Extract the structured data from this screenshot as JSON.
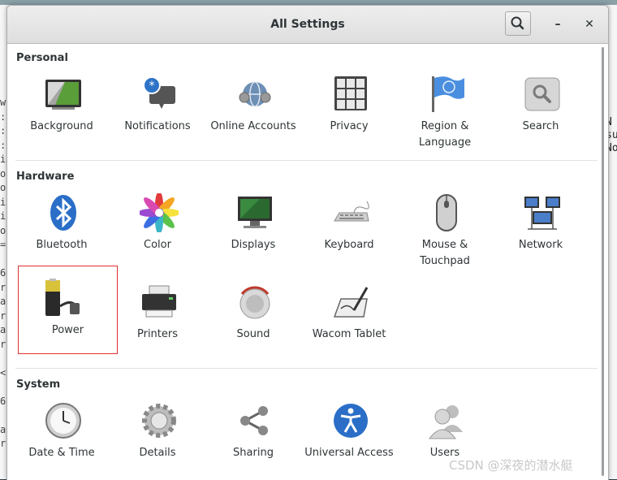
{
  "window": {
    "title": "All Settings",
    "search_button": "search-icon",
    "minimize_label": "–",
    "close_label": "✕"
  },
  "sections": {
    "personal": {
      "title": "Personal",
      "items": [
        {
          "label": "Background",
          "icon": "background-icon"
        },
        {
          "label": "Notifications",
          "icon": "notifications-icon"
        },
        {
          "label": "Online Accounts",
          "icon": "online-accounts-icon"
        },
        {
          "label": "Privacy",
          "icon": "privacy-icon"
        },
        {
          "label": "Region & Language",
          "icon": "region-language-icon"
        },
        {
          "label": "Search",
          "icon": "search-icon"
        }
      ]
    },
    "hardware": {
      "title": "Hardware",
      "items": [
        {
          "label": "Bluetooth",
          "icon": "bluetooth-icon"
        },
        {
          "label": "Color",
          "icon": "color-icon"
        },
        {
          "label": "Displays",
          "icon": "displays-icon"
        },
        {
          "label": "Keyboard",
          "icon": "keyboard-icon"
        },
        {
          "label": "Mouse & Touchpad",
          "icon": "mouse-icon"
        },
        {
          "label": "Network",
          "icon": "network-icon"
        },
        {
          "label": "Power",
          "icon": "power-icon"
        },
        {
          "label": "Printers",
          "icon": "printer-icon"
        },
        {
          "label": "Sound",
          "icon": "sound-icon"
        },
        {
          "label": "Wacom Tablet",
          "icon": "wacom-tablet-icon"
        }
      ]
    },
    "system": {
      "title": "System",
      "items": [
        {
          "label": "Date & Time",
          "icon": "clock-icon"
        },
        {
          "label": "Details",
          "icon": "gear-icon"
        },
        {
          "label": "Sharing",
          "icon": "share-icon"
        },
        {
          "label": "Universal Access",
          "icon": "accessibility-icon"
        },
        {
          "label": "Users",
          "icon": "users-icon"
        }
      ]
    }
  },
  "selected_item": "Power",
  "background_terminal": {
    "left_column": "w\n:\n:\n:\ni\no\no\ni\ni\no\n=\n\n6\nr\na\nr\na\nr\n\n<\n\n6\n\na\nr",
    "right_column": "N\nsu\nNo"
  },
  "watermark": "CSDN @深夜的潜水艇",
  "colors": {
    "selection_border": "#e0312f",
    "header_bg": "#e4e4e4",
    "text": "#2e3436"
  }
}
